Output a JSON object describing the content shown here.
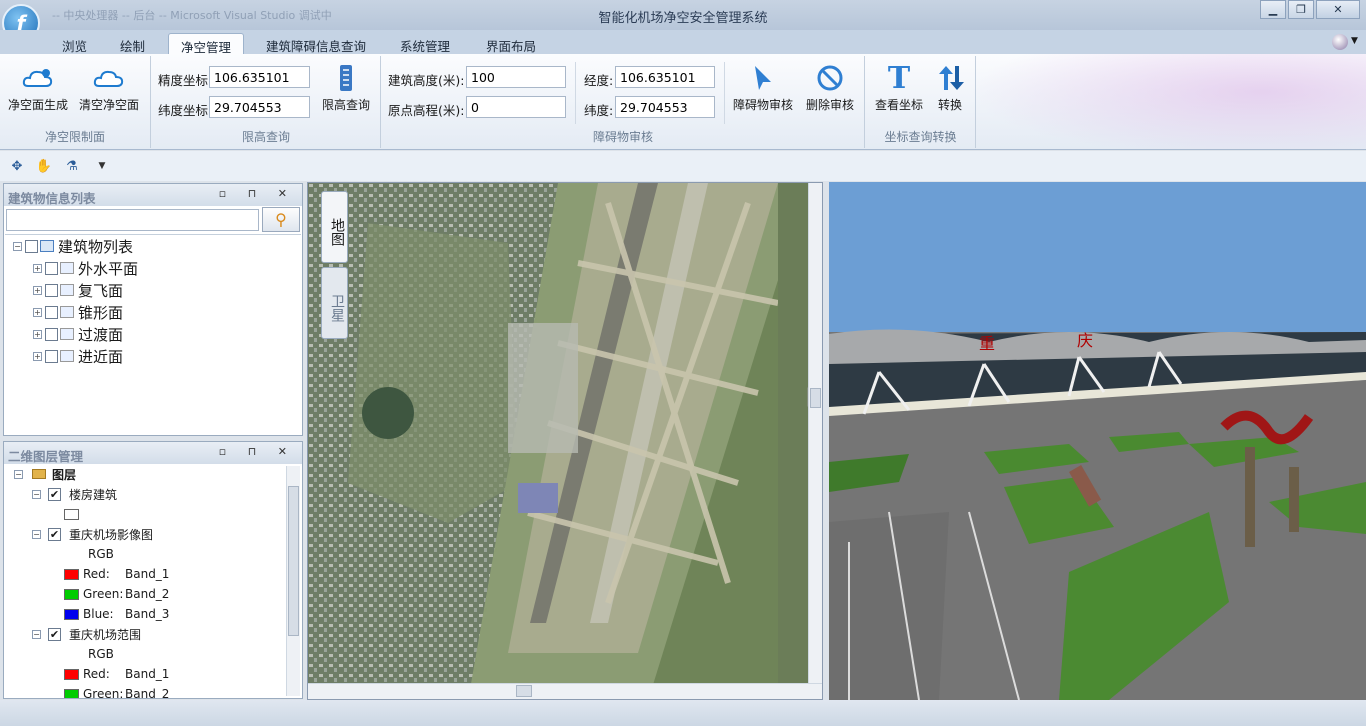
{
  "window": {
    "title": "智能化机场净空安全管理系统",
    "faded_left": "-- 中央处理器 -- 后台 -- Microsoft Visual Studio 调试中"
  },
  "tabs": [
    "浏览",
    "绘制",
    "净空管理",
    "建筑障碍信息查询",
    "系统管理",
    "界面布局"
  ],
  "active_tab": "净空管理",
  "ribbon": {
    "g1": {
      "label": "净空限制面",
      "btn1": "净空面生成",
      "btn2": "清空净空面"
    },
    "g2": {
      "label": "限高查询",
      "lon_label": "精度坐标",
      "lon": "106.635101",
      "lat_label": "纬度坐标",
      "lat": "29.704553",
      "btn": "限高查询"
    },
    "g3": {
      "label": "障碍物审核",
      "h_label": "建筑高度(米):",
      "h": "100",
      "o_label": "原点高程(米):",
      "o": "0",
      "lon_label": "经度:",
      "lon": "106.635101",
      "lat_label": "纬度:",
      "lat": "29.704553",
      "btn1": "障碍物审核",
      "btn2": "删除审核"
    },
    "g4": {
      "label": "坐标查询转换",
      "btn1": "查看坐标",
      "btn2": "转换"
    }
  },
  "building_panel": {
    "title": "建筑物信息列表",
    "search_value": "",
    "root": "建筑物列表",
    "items": [
      "外水平面",
      "复飞面",
      "锥形面",
      "过渡面",
      "进近面"
    ]
  },
  "layer_panel": {
    "title": "二维图层管理",
    "root": "图层",
    "l1": "楼房建筑",
    "l2": "重庆机场影像图",
    "rgb": "RGB",
    "bands": [
      {
        "label": "Red:",
        "band": "Band_1"
      },
      {
        "label": "Green:",
        "band": "Band_2"
      },
      {
        "label": "Blue:",
        "band": "Band_3"
      }
    ],
    "l3": "重庆机场范围",
    "rgb2": "RGB",
    "bands2": [
      {
        "label": "Red:",
        "band": "Band_1"
      },
      {
        "label": "Green:",
        "band": "Band_2"
      }
    ]
  },
  "map_tabs": {
    "map": "地图",
    "satellite": "卫星"
  },
  "colors": {
    "red": "#ff0000",
    "green": "#00cc00",
    "blue": "#0000ee",
    "sky": "#6c9ed4"
  }
}
